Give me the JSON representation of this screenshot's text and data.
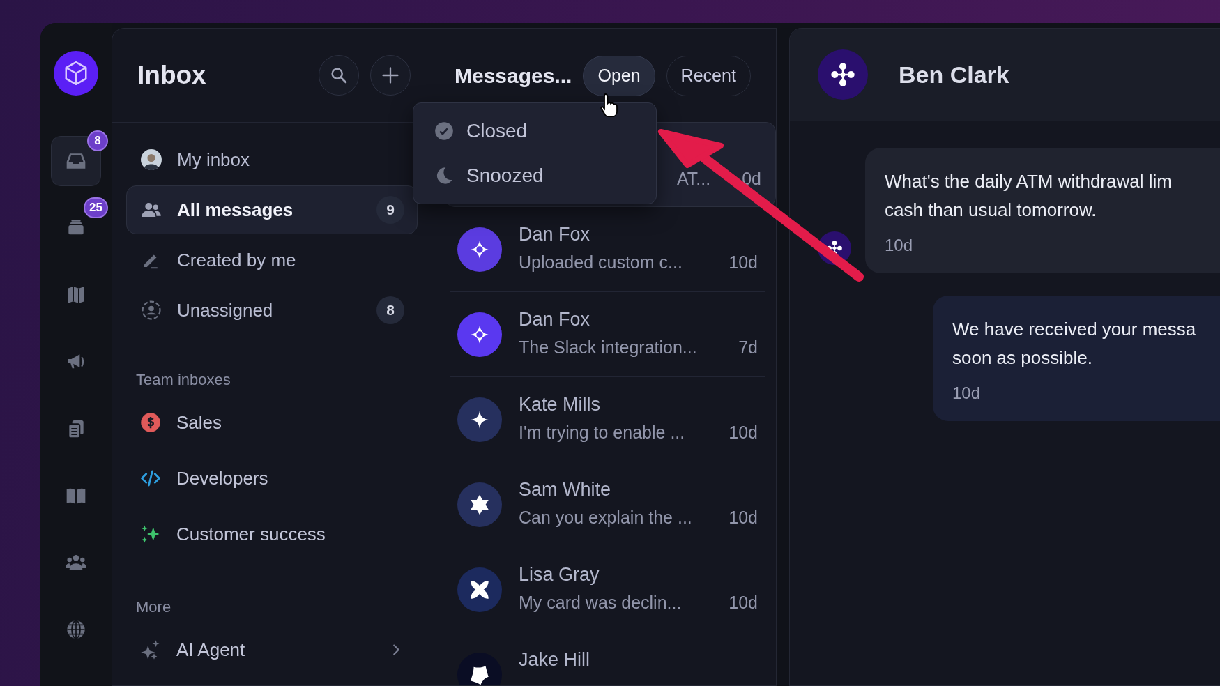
{
  "rail": {
    "items": [
      {
        "kind": "inbox",
        "selected": true,
        "badge": "8"
      },
      {
        "kind": "stack",
        "selected": false,
        "badge": "25"
      },
      {
        "kind": "map",
        "selected": false
      },
      {
        "kind": "megaphone",
        "selected": false
      },
      {
        "kind": "documents",
        "selected": false
      },
      {
        "kind": "book",
        "selected": false
      },
      {
        "kind": "people",
        "selected": false
      },
      {
        "kind": "globe",
        "selected": false
      }
    ]
  },
  "sidebar": {
    "title": "Inbox",
    "nav": [
      {
        "kind": "avatar",
        "label": "My inbox",
        "selected": false
      },
      {
        "kind": "people",
        "label": "All messages",
        "count": "9",
        "selected": true
      },
      {
        "kind": "pencil",
        "label": "Created by me",
        "selected": false
      },
      {
        "kind": "unassigned",
        "label": "Unassigned",
        "count": "8",
        "selected": false
      }
    ],
    "sections": [
      {
        "heading": "Team inboxes",
        "items": [
          {
            "kind": "dollar",
            "label": "Sales",
            "color": "#e05a5a"
          },
          {
            "kind": "code",
            "label": "Developers",
            "color": "#2e9fe0"
          },
          {
            "kind": "sparkle",
            "label": "Customer success",
            "color": "#3ec46d"
          }
        ]
      },
      {
        "heading": "More",
        "items": [
          {
            "kind": "ai",
            "label": "AI Agent",
            "expandable": true
          }
        ]
      }
    ]
  },
  "list": {
    "title": "Messages...",
    "filters": [
      {
        "label": "Open",
        "selected": true
      },
      {
        "label": "Recent",
        "selected": false
      }
    ],
    "rows": [
      {
        "preview": "AT...",
        "time": "0d",
        "selected": true
      },
      {
        "kind": "diamond",
        "color": "#5b3ce0",
        "name": "Dan Fox",
        "preview": "Uploaded custom c...",
        "time": "10d",
        "selected": false
      },
      {
        "kind": "diamond",
        "color": "#5a38f0",
        "name": "Dan Fox",
        "preview": "The Slack integration...",
        "time": "7d",
        "selected": false
      },
      {
        "kind": "sparkle",
        "color": "#26305e",
        "name": "Kate Mills",
        "preview": "I'm trying to enable ...",
        "time": "10d",
        "selected": false
      },
      {
        "kind": "star",
        "color": "#26305e",
        "name": "Sam White",
        "preview": "Can you explain the ...",
        "time": "10d",
        "selected": false
      },
      {
        "kind": "flower",
        "color": "#1c2a5e",
        "name": "Lisa Gray",
        "preview": "My card was declin...",
        "time": "10d",
        "selected": false
      },
      {
        "kind": "blob",
        "color": "#0a0d24",
        "name": "Jake Hill",
        "selected": false
      }
    ]
  },
  "dropdown": {
    "items": [
      {
        "kind": "check",
        "label": "Closed"
      },
      {
        "kind": "moon",
        "label": "Snoozed"
      }
    ]
  },
  "conversation": {
    "contact": "Ben Clark",
    "messages": [
      {
        "kind": "incoming",
        "lines": [
          "What's the daily ATM withdrawal lim",
          "cash than usual tomorrow."
        ],
        "time": "10d"
      },
      {
        "kind": "outgoing",
        "lines": [
          "We have received your messa",
          "soon as possible."
        ],
        "time": "10d"
      }
    ]
  }
}
